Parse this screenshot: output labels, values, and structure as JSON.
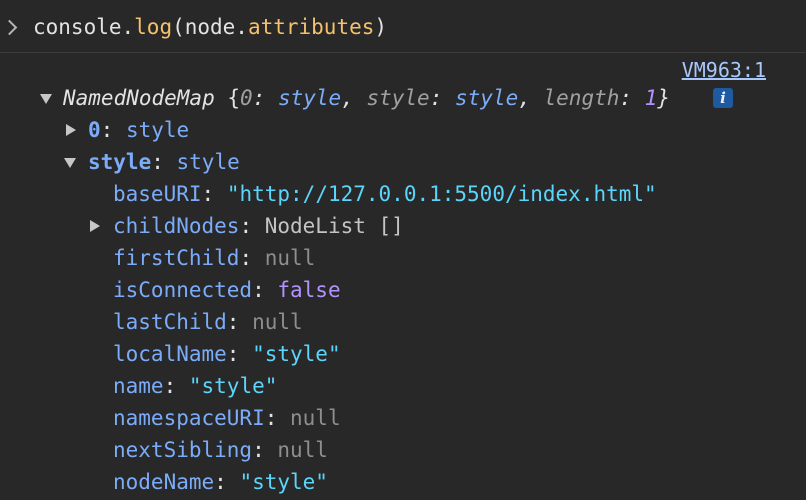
{
  "input": {
    "code_prefix": "console.",
    "code_fn": "log",
    "code_suffix": "(node.",
    "code_attr": "attributes",
    "code_close": ")"
  },
  "source_link": "VM963:1",
  "root": {
    "type": "NamedNodeMap",
    "open_brace": " {",
    "k0": "0",
    "v0": "style",
    "k1": "style",
    "v1": "style",
    "k2": "length",
    "v2": "1",
    "close_brace": "}",
    "info": "i"
  },
  "children": {
    "item0_key": "0",
    "item0_val": "style",
    "style_key": "style",
    "style_val": "style"
  },
  "props": [
    {
      "key": "baseURI",
      "value": "\"http://127.0.0.1:5500/index.html\"",
      "kind": "str"
    },
    {
      "key": "childNodes",
      "value": "NodeList []",
      "kind": "obj"
    },
    {
      "key": "firstChild",
      "value": "null",
      "kind": "null"
    },
    {
      "key": "isConnected",
      "value": "false",
      "kind": "bool"
    },
    {
      "key": "lastChild",
      "value": "null",
      "kind": "null"
    },
    {
      "key": "localName",
      "value": "\"style\"",
      "kind": "str"
    },
    {
      "key": "name",
      "value": "\"style\"",
      "kind": "str"
    },
    {
      "key": "namespaceURI",
      "value": "null",
      "kind": "null"
    },
    {
      "key": "nextSibling",
      "value": "null",
      "kind": "null"
    },
    {
      "key": "nodeName",
      "value": "\"style\"",
      "kind": "str"
    }
  ],
  "colors": {
    "background": "#282828",
    "key": "#7cacf8",
    "string": "#5cd5fb",
    "null": "#8e8e8e",
    "bool": "#b493ff",
    "function": "#f5c16c"
  },
  "icons": {
    "prompt": "chevron-right-icon",
    "expand": "triangle-down-icon",
    "collapse": "triangle-right-icon",
    "info": "info-icon"
  }
}
